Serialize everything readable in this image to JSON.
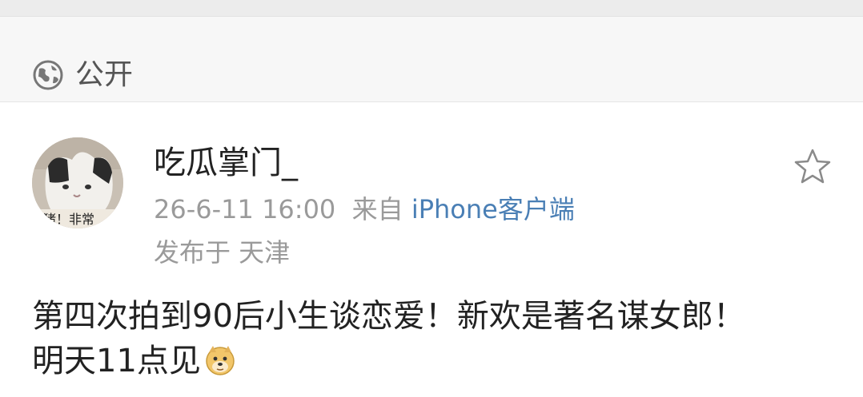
{
  "visibility": {
    "icon": "globe-icon",
    "label": "公开"
  },
  "post": {
    "author": {
      "name": "吃瓜掌门_",
      "avatar": "cat-avatar"
    },
    "timestamp": "26-6-11 16:00",
    "source_prefix": "来自",
    "source": "iPhone客户端",
    "location": "发布于 天津",
    "favorite_icon": "star-icon",
    "text_line1": "第四次拍到90后小生谈恋爱！新欢是著名谋女郎！",
    "text_line2": "明天11点见",
    "emoji": "doge-icon"
  }
}
